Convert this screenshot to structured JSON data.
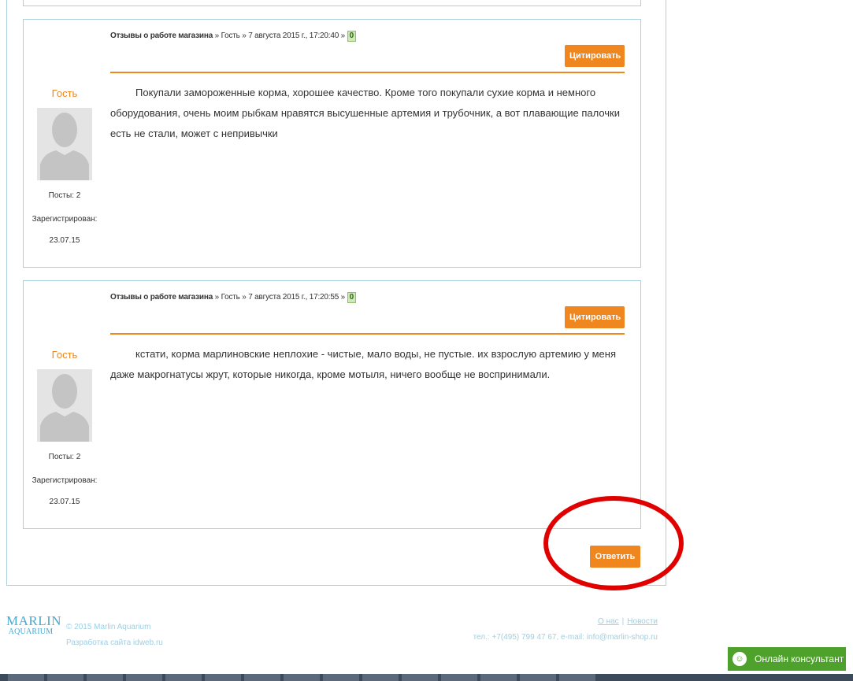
{
  "posts": [
    {
      "forum_link": "Отзывы о работе магазина",
      "meta_rest": " » Гость » 7 августа 2015 г., 17:20:40 » ",
      "rating": "0",
      "quote_label": "Цитировать",
      "author": "Гость",
      "posts_count": "Посты: 2",
      "registered_label": "Зарегистрирован:",
      "registered_date": "23.07.15",
      "text": "Покупали замороженные корма, хорошее качество. Кроме того покупали сухие корма и немного оборудования, очень моим рыбкам нравятся высушенные артемия и трубочник, а вот плавающие палочки есть не стали, может с непривычки"
    },
    {
      "forum_link": "Отзывы о работе магазина",
      "meta_rest": " » Гость » 7 августа 2015 г., 17:20:55 » ",
      "rating": "0",
      "quote_label": "Цитировать",
      "author": "Гость",
      "posts_count": "Посты: 2",
      "registered_label": "Зарегистрирован:",
      "registered_date": "23.07.15",
      "text": "кстати, корма марлиновские неплохие - чистые, мало воды, не пустые. их взрослую артемию у меня даже макрогнатусы жрут, которые никогда, кроме мотыля, ничего вообще не воспринимали."
    }
  ],
  "reply_label": "Ответить",
  "footer": {
    "logo_line1": "MARLIN",
    "logo_line2": "AQUARIUM",
    "copyright": "© 2015 Marlin Aquarium",
    "developer": "Разработка сайта idweb.ru",
    "link_about": "О нас",
    "link_news": "Новости",
    "link_separator": "|",
    "contacts": "тел.: +7(495) 799 47 67, e-mail: info@marlin-shop.ru"
  },
  "consultant": {
    "label": "Онлайн консультант",
    "icon": "chat-icon"
  },
  "colors": {
    "accent": "#f0861e",
    "border": "#a9cfe0",
    "annotation": "#e00000",
    "consultant_bg": "#4ea12a"
  }
}
